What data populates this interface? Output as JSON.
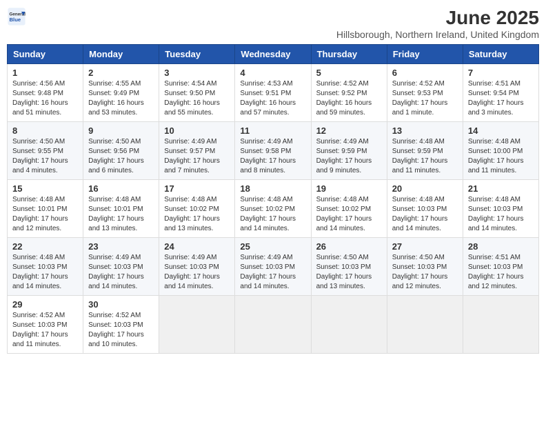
{
  "logo": {
    "general": "General",
    "blue": "Blue"
  },
  "title": "June 2025",
  "subtitle": "Hillsborough, Northern Ireland, United Kingdom",
  "days": [
    "Sunday",
    "Monday",
    "Tuesday",
    "Wednesday",
    "Thursday",
    "Friday",
    "Saturday"
  ],
  "weeks": [
    [
      {
        "day": "1",
        "sunrise": "4:56 AM",
        "sunset": "9:48 PM",
        "daylight": "16 hours and 51 minutes."
      },
      {
        "day": "2",
        "sunrise": "4:55 AM",
        "sunset": "9:49 PM",
        "daylight": "16 hours and 53 minutes."
      },
      {
        "day": "3",
        "sunrise": "4:54 AM",
        "sunset": "9:50 PM",
        "daylight": "16 hours and 55 minutes."
      },
      {
        "day": "4",
        "sunrise": "4:53 AM",
        "sunset": "9:51 PM",
        "daylight": "16 hours and 57 minutes."
      },
      {
        "day": "5",
        "sunrise": "4:52 AM",
        "sunset": "9:52 PM",
        "daylight": "16 hours and 59 minutes."
      },
      {
        "day": "6",
        "sunrise": "4:52 AM",
        "sunset": "9:53 PM",
        "daylight": "17 hours and 1 minute."
      },
      {
        "day": "7",
        "sunrise": "4:51 AM",
        "sunset": "9:54 PM",
        "daylight": "17 hours and 3 minutes."
      }
    ],
    [
      {
        "day": "8",
        "sunrise": "4:50 AM",
        "sunset": "9:55 PM",
        "daylight": "17 hours and 4 minutes."
      },
      {
        "day": "9",
        "sunrise": "4:50 AM",
        "sunset": "9:56 PM",
        "daylight": "17 hours and 6 minutes."
      },
      {
        "day": "10",
        "sunrise": "4:49 AM",
        "sunset": "9:57 PM",
        "daylight": "17 hours and 7 minutes."
      },
      {
        "day": "11",
        "sunrise": "4:49 AM",
        "sunset": "9:58 PM",
        "daylight": "17 hours and 8 minutes."
      },
      {
        "day": "12",
        "sunrise": "4:49 AM",
        "sunset": "9:59 PM",
        "daylight": "17 hours and 9 minutes."
      },
      {
        "day": "13",
        "sunrise": "4:48 AM",
        "sunset": "9:59 PM",
        "daylight": "17 hours and 11 minutes."
      },
      {
        "day": "14",
        "sunrise": "4:48 AM",
        "sunset": "10:00 PM",
        "daylight": "17 hours and 11 minutes."
      }
    ],
    [
      {
        "day": "15",
        "sunrise": "4:48 AM",
        "sunset": "10:01 PM",
        "daylight": "17 hours and 12 minutes."
      },
      {
        "day": "16",
        "sunrise": "4:48 AM",
        "sunset": "10:01 PM",
        "daylight": "17 hours and 13 minutes."
      },
      {
        "day": "17",
        "sunrise": "4:48 AM",
        "sunset": "10:02 PM",
        "daylight": "17 hours and 13 minutes."
      },
      {
        "day": "18",
        "sunrise": "4:48 AM",
        "sunset": "10:02 PM",
        "daylight": "17 hours and 14 minutes."
      },
      {
        "day": "19",
        "sunrise": "4:48 AM",
        "sunset": "10:02 PM",
        "daylight": "17 hours and 14 minutes."
      },
      {
        "day": "20",
        "sunrise": "4:48 AM",
        "sunset": "10:03 PM",
        "daylight": "17 hours and 14 minutes."
      },
      {
        "day": "21",
        "sunrise": "4:48 AM",
        "sunset": "10:03 PM",
        "daylight": "17 hours and 14 minutes."
      }
    ],
    [
      {
        "day": "22",
        "sunrise": "4:48 AM",
        "sunset": "10:03 PM",
        "daylight": "17 hours and 14 minutes."
      },
      {
        "day": "23",
        "sunrise": "4:49 AM",
        "sunset": "10:03 PM",
        "daylight": "17 hours and 14 minutes."
      },
      {
        "day": "24",
        "sunrise": "4:49 AM",
        "sunset": "10:03 PM",
        "daylight": "17 hours and 14 minutes."
      },
      {
        "day": "25",
        "sunrise": "4:49 AM",
        "sunset": "10:03 PM",
        "daylight": "17 hours and 14 minutes."
      },
      {
        "day": "26",
        "sunrise": "4:50 AM",
        "sunset": "10:03 PM",
        "daylight": "17 hours and 13 minutes."
      },
      {
        "day": "27",
        "sunrise": "4:50 AM",
        "sunset": "10:03 PM",
        "daylight": "17 hours and 12 minutes."
      },
      {
        "day": "28",
        "sunrise": "4:51 AM",
        "sunset": "10:03 PM",
        "daylight": "17 hours and 12 minutes."
      }
    ],
    [
      {
        "day": "29",
        "sunrise": "4:52 AM",
        "sunset": "10:03 PM",
        "daylight": "17 hours and 11 minutes."
      },
      {
        "day": "30",
        "sunrise": "4:52 AM",
        "sunset": "10:03 PM",
        "daylight": "17 hours and 10 minutes."
      },
      null,
      null,
      null,
      null,
      null
    ]
  ]
}
